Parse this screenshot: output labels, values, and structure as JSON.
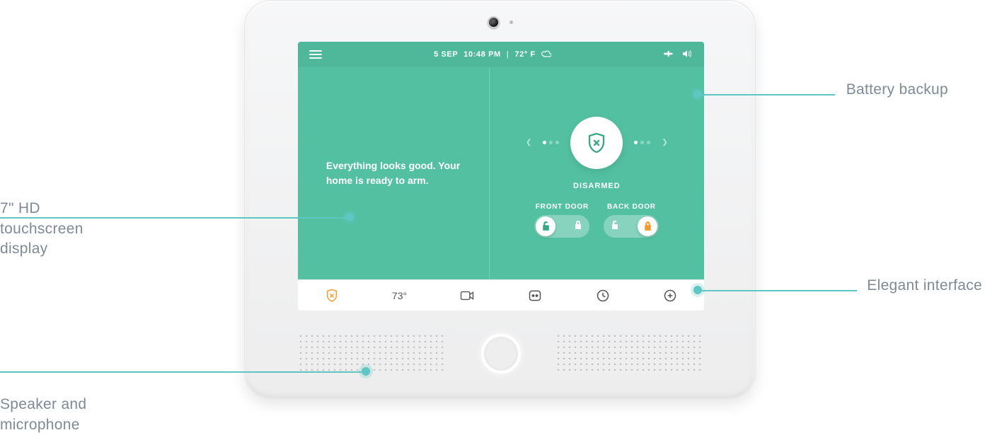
{
  "callouts": {
    "battery": "Battery backup",
    "touchscreen": "7\" HD\ntouchscreen\ndisplay",
    "interface": "Elegant interface",
    "speaker": "Speaker and\nmicrophone"
  },
  "topbar": {
    "date": "5  SEP",
    "time": "10:48 PM",
    "separator": "|",
    "weather": "72° F"
  },
  "main": {
    "status_message": "Everything looks good. Your home is ready to arm.",
    "arm_state": "DISARMED",
    "doors": [
      {
        "label": "FRONT DOOR",
        "locked": false
      },
      {
        "label": "BACK DOOR",
        "locked": true
      }
    ]
  },
  "tabbar": {
    "temp": "73°"
  },
  "colors": {
    "screen_green": "#53c1a1",
    "header_green": "#4fb89a",
    "accent_orange": "#f39a2c",
    "accent_teal": "#5ec7c3",
    "arm_teal": "#3aa688"
  }
}
